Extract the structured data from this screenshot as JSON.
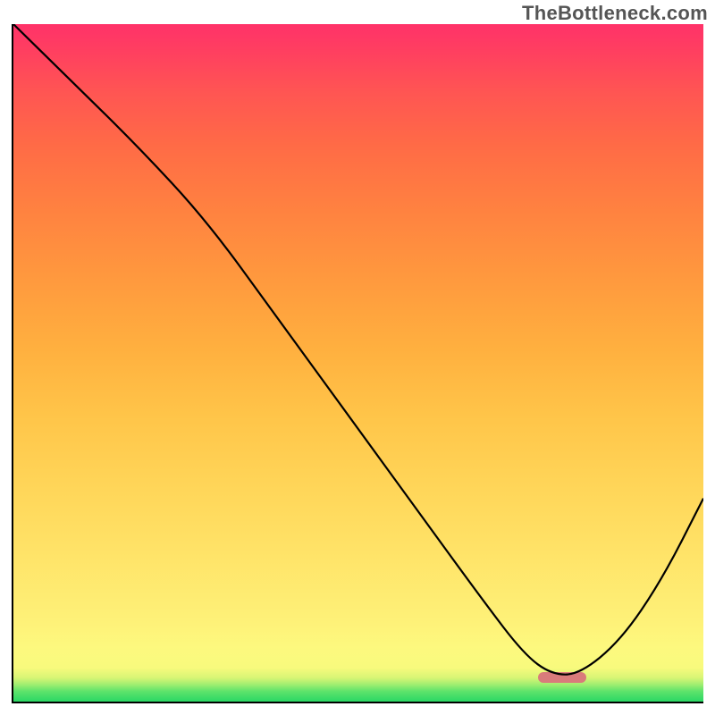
{
  "watermark": "TheBottleneck.com",
  "chart_data": {
    "type": "line",
    "title": "",
    "xlabel": "",
    "ylabel": "",
    "xlim": [
      0,
      100
    ],
    "ylim": [
      0,
      100
    ],
    "grid": false,
    "legend": false,
    "background": {
      "type": "vertical-gradient",
      "stops": [
        {
          "pos": 0,
          "color": "#ff3269"
        },
        {
          "pos": 50,
          "color": "#ffba44"
        },
        {
          "pos": 92,
          "color": "#fdf97e"
        },
        {
          "pos": 100,
          "color": "#2bd865"
        }
      ]
    },
    "series": [
      {
        "name": "bottleneck-curve",
        "color": "#000000",
        "x": [
          0,
          8,
          18,
          28,
          38,
          48,
          58,
          68,
          74,
          78,
          82,
          88,
          94,
          100
        ],
        "y": [
          100,
          92,
          82,
          71,
          57,
          43,
          29,
          15,
          7,
          4,
          4,
          9,
          18,
          30
        ]
      }
    ],
    "annotations": [
      {
        "name": "optimal-marker",
        "type": "bar-marker",
        "color": "#d97b7b",
        "x_start": 76,
        "x_end": 83,
        "y": 3.5
      }
    ]
  }
}
